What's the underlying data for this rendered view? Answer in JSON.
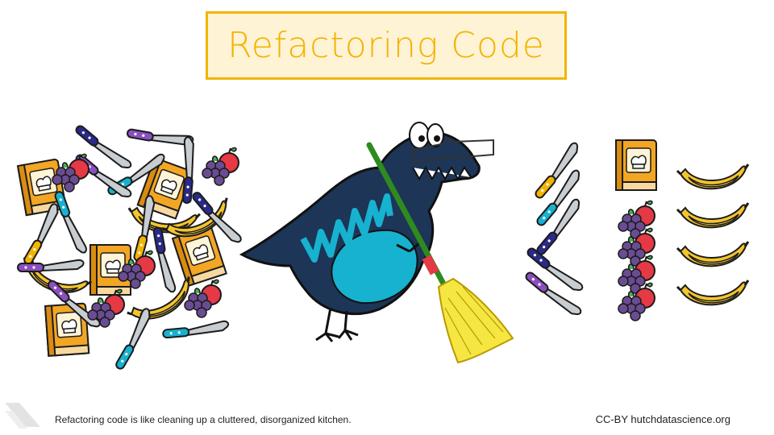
{
  "title": "Refactoring Code",
  "caption": "Refactoring code is like cleaning up a cluttered, disorganized kitchen.",
  "credit": "CC-BY hutchdatascience.org",
  "colors": {
    "title_border": "#f2b400",
    "title_fill": "#fff3d6",
    "title_text": "#f2b400",
    "dino_body": "#1d3557",
    "dino_accent": "#17b2d0",
    "broom_handle": "#2e8b1f",
    "broom_straw": "#f5e642",
    "book": "#f2a624",
    "banana": "#f5c52d",
    "apple": "#e63946",
    "grape": "#6a4c93"
  },
  "icons": [
    "knife-icon",
    "cookbook-icon",
    "apple-grape-icon",
    "banana-icon",
    "dinosaur-icon",
    "broom-icon",
    "glasses-icon"
  ]
}
